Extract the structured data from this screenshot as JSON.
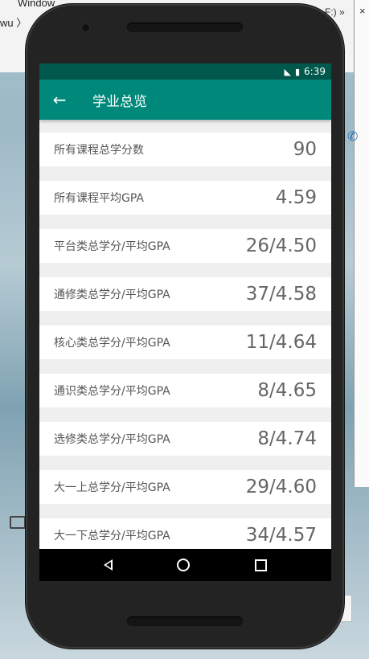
{
  "desktop": {
    "title_fragment": "Window",
    "address_fragment": "wu 〉",
    "right_fragment": "F:) »",
    "close_glyph": "×"
  },
  "status_bar": {
    "time": "6:39",
    "network_icon": "lte-signal-icon",
    "battery_icon": "battery-charging-icon"
  },
  "app_bar": {
    "title": "学业总览",
    "back_icon": "arrow-left-icon"
  },
  "items": [
    {
      "label": "所有课程总学分数",
      "value": "90"
    },
    {
      "label": "所有课程平均GPA",
      "value": "4.59"
    },
    {
      "label": "平台类总学分/平均GPA",
      "value": "26/4.50"
    },
    {
      "label": "通修类总学分/平均GPA",
      "value": "37/4.58"
    },
    {
      "label": "核心类总学分/平均GPA",
      "value": "11/4.64"
    },
    {
      "label": "通识类总学分/平均GPA",
      "value": "8/4.65"
    },
    {
      "label": "选修类总学分/平均GPA",
      "value": "8/4.74"
    },
    {
      "label": "大一上总学分/平均GPA",
      "value": "29/4.60"
    },
    {
      "label": "大一下总学分/平均GPA",
      "value": "34/4.57"
    }
  ],
  "colors": {
    "app_bar": "#00897b",
    "status_bar": "#00574b",
    "list_bg": "#efefef"
  }
}
